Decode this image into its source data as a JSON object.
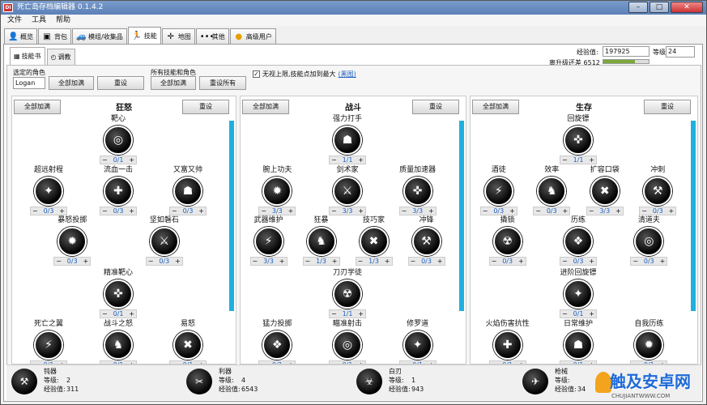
{
  "window": {
    "title": "死亡岛存档编辑器 0.1.4.2",
    "app_icon": "DI"
  },
  "menu": [
    "文件",
    "工具",
    "帮助"
  ],
  "tabs": [
    {
      "label": "概览",
      "icon": "person-icon"
    },
    {
      "label": "背包",
      "icon": "bag-icon"
    },
    {
      "label": "模组/收集品",
      "icon": "car-icon"
    },
    {
      "label": "技能",
      "icon": "skill-icon"
    },
    {
      "label": "地图",
      "icon": "map-icon"
    },
    {
      "label": "其他",
      "icon": "dots-icon"
    },
    {
      "label": "高级用户",
      "icon": "coin-icon"
    }
  ],
  "subtabs": [
    {
      "label": "技能书",
      "icon": "grid-icon"
    },
    {
      "label": "调教",
      "icon": "tune-icon"
    }
  ],
  "xp": {
    "label": "经验值:",
    "value": "197925",
    "level_label": "等级:",
    "level": "24",
    "next_label": "离升级还差 6512",
    "progress": 0.7
  },
  "selected_role": {
    "label": "选定的角色",
    "value": "Logan",
    "max_all": "全部加满",
    "reset": "重设"
  },
  "all_skills": {
    "label": "所有技能和角色",
    "max_all": "全部加满",
    "reset_all": "重设所有"
  },
  "ignore_limit": {
    "checked": true,
    "label": "无视上限,技能点加到最大",
    "link": "(黑图)"
  },
  "columns": [
    {
      "title": "狂怒",
      "max_btn": "全部加满",
      "reset_btn": "重设",
      "skills": [
        {
          "name": "靶心",
          "value": "0/1"
        },
        {
          "name": "超远射程",
          "value": "0/3"
        },
        {
          "name": "流血一击",
          "value": "0/3"
        },
        {
          "name": "又富又帅",
          "value": "0/3"
        },
        {
          "name": "暴怒投掷",
          "value": "0/3"
        },
        {
          "name": "坚如磐石",
          "value": "0/3"
        },
        {
          "name": "精准靶心",
          "value": "0/1"
        },
        {
          "name": "死亡之翼",
          "value": "0/1"
        },
        {
          "name": "战斗之怒",
          "value": "0/1"
        },
        {
          "name": "易怒",
          "value": "0/1"
        }
      ]
    },
    {
      "title": "战斗",
      "max_btn": "全部加满",
      "reset_btn": "重设",
      "skills": [
        {
          "name": "强力打手",
          "value": "1/1"
        },
        {
          "name": "腕上功夫",
          "value": "3/3"
        },
        {
          "name": "剑术家",
          "value": "3/3"
        },
        {
          "name": "质量加速器",
          "value": "3/3"
        },
        {
          "name": "武器维护",
          "value": "3/3"
        },
        {
          "name": "狂暴",
          "value": "1/3"
        },
        {
          "name": "技巧家",
          "value": "1/3"
        },
        {
          "name": "冲锋",
          "value": "0/3"
        },
        {
          "name": "刀刃学徒",
          "value": "1/1"
        },
        {
          "name": "猛力投掷",
          "value": "0/1"
        },
        {
          "name": "瞄准射击",
          "value": "0/1"
        },
        {
          "name": "修罗道",
          "value": "0/1"
        }
      ]
    },
    {
      "title": "生存",
      "max_btn": "全部加满",
      "reset_btn": "重设",
      "skills": [
        {
          "name": "回旋镖",
          "value": "1/1"
        },
        {
          "name": "酒徒",
          "value": "0/3"
        },
        {
          "name": "效率",
          "value": "0/3"
        },
        {
          "name": "扩容口袋",
          "value": "3/3"
        },
        {
          "name": "冲刺",
          "value": "0/3"
        },
        {
          "name": "撬锁",
          "value": "0/3"
        },
        {
          "name": "历练",
          "value": "0/3"
        },
        {
          "name": "清道夫",
          "value": "0/3"
        },
        {
          "name": "进阶回旋镖",
          "value": "0/1"
        },
        {
          "name": "火焰伤害抗性",
          "value": "0/1"
        },
        {
          "name": "日常维护",
          "value": "0/1"
        },
        {
          "name": "自我历练",
          "value": "0/1"
        }
      ]
    }
  ],
  "weapons": [
    {
      "name": "钝器",
      "level_label": "等级:",
      "level": "2",
      "xp_label": "经验值:",
      "xp": "311"
    },
    {
      "name": "利器",
      "level_label": "等级:",
      "level": "4",
      "xp_label": "经验值:",
      "xp": "6543"
    },
    {
      "name": "白刃",
      "level_label": "等级:",
      "level": "1",
      "xp_label": "经验值:",
      "xp": "943"
    },
    {
      "name": "枪械",
      "level_label": "等级:",
      "level": "",
      "xp_label": "经验值:",
      "xp": "34"
    }
  ],
  "watermark": {
    "text": "触及安卓网",
    "sub": "CHUJIANTWWW.COM"
  }
}
